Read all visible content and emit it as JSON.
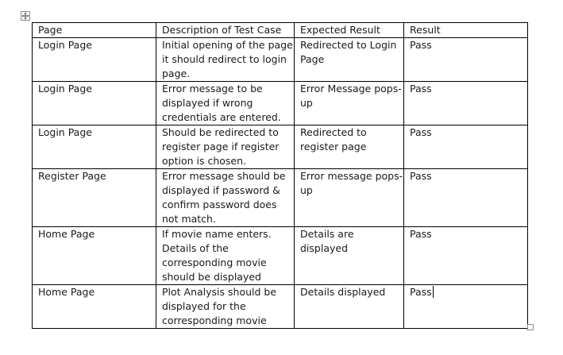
{
  "table": {
    "headers": [
      "Page",
      "Description of Test Case",
      "Expected Result",
      "Result"
    ],
    "rows": [
      {
        "page": "Login Page",
        "description": "Initial opening of the page it should redirect to login page.",
        "expected": "Redirected to Login Page",
        "result": "Pass"
      },
      {
        "page": "Login Page",
        "description": "Error message to be displayed if wrong credentials are entered.",
        "expected": "Error Message pops-up",
        "result": "Pass"
      },
      {
        "page": "Login Page",
        "description": "Should be redirected to register page if register option is chosen.",
        "expected": "Redirected to register page",
        "result": "Pass"
      },
      {
        "page": "Register Page",
        "description": "Error message should be displayed if password & confirm password does not match.",
        "expected": "Error message pops-up",
        "result": "Pass"
      },
      {
        "page": "Home Page",
        "description": "If movie name enters. Details of the corresponding movie should be displayed",
        "expected": "Details are displayed",
        "result": "Pass"
      },
      {
        "page": "Home Page",
        "description": "Plot Analysis should be displayed for the corresponding movie",
        "expected": "Details displayed",
        "result": "Pass"
      }
    ]
  },
  "icons": {
    "move_handle": "move-arrows-icon",
    "resize_handle": "resize-square-icon"
  },
  "colors": {
    "border": "#000000",
    "text": "#1a1a1a",
    "handle_border": "#8c8c8c"
  }
}
